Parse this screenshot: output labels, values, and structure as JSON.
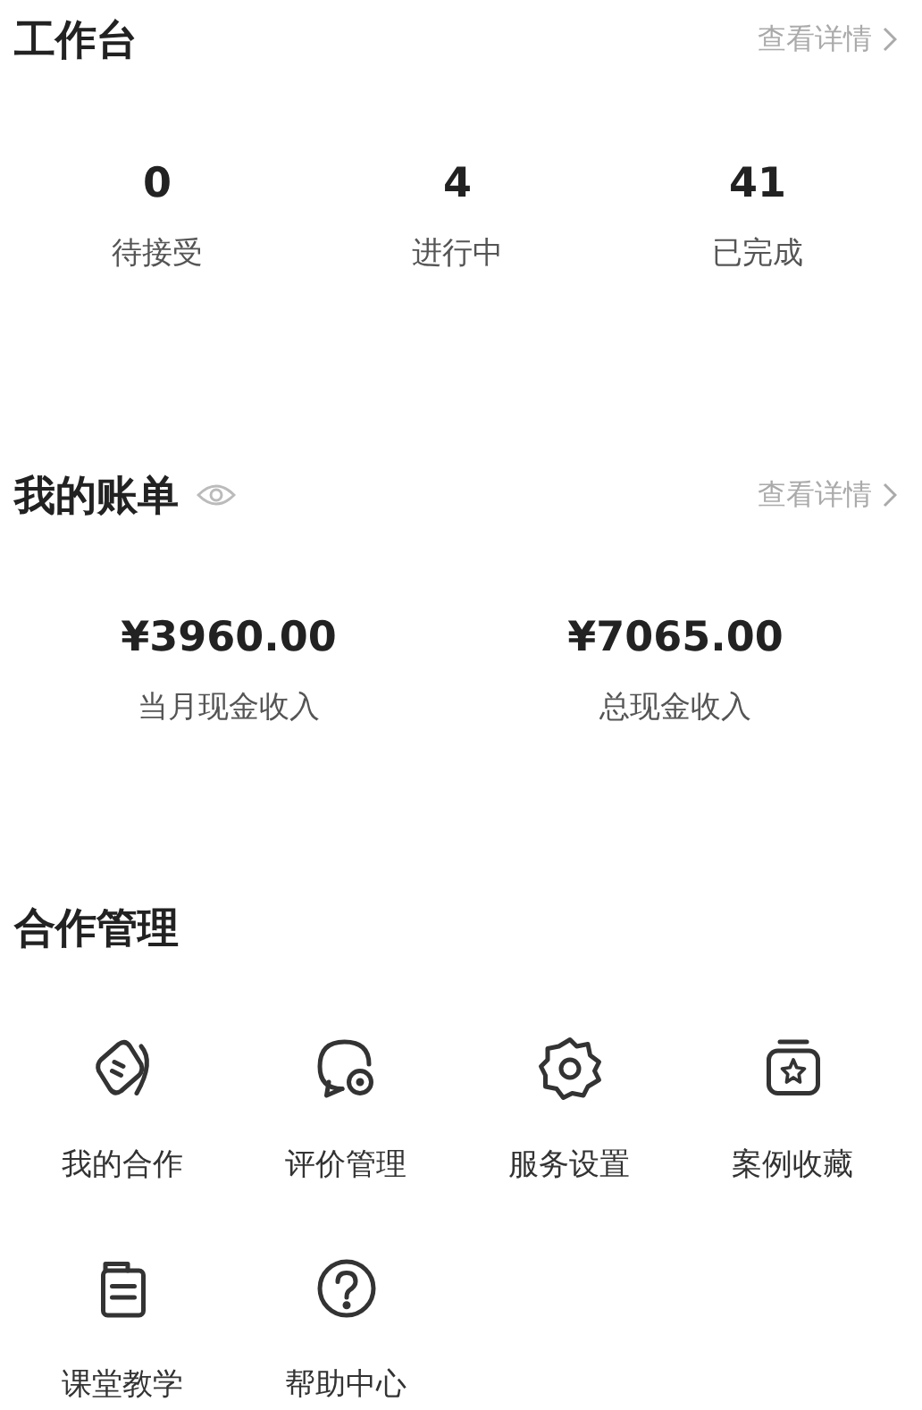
{
  "workbench": {
    "title": "工作台",
    "more_link": "查看详情",
    "stats": [
      {
        "value": "0",
        "label": "待接受"
      },
      {
        "value": "4",
        "label": "进行中"
      },
      {
        "value": "41",
        "label": "已完成"
      }
    ]
  },
  "bill": {
    "title": "我的账单",
    "more_link": "查看详情",
    "amounts": [
      {
        "value": "¥3960.00",
        "label": "当月现金收入"
      },
      {
        "value": "¥7065.00",
        "label": "总现金收入"
      }
    ]
  },
  "cooperation": {
    "title": "合作管理",
    "items": [
      {
        "label": "我的合作"
      },
      {
        "label": "评价管理"
      },
      {
        "label": "服务设置"
      },
      {
        "label": "案例收藏"
      },
      {
        "label": "课堂教学"
      },
      {
        "label": "帮助中心"
      }
    ]
  }
}
